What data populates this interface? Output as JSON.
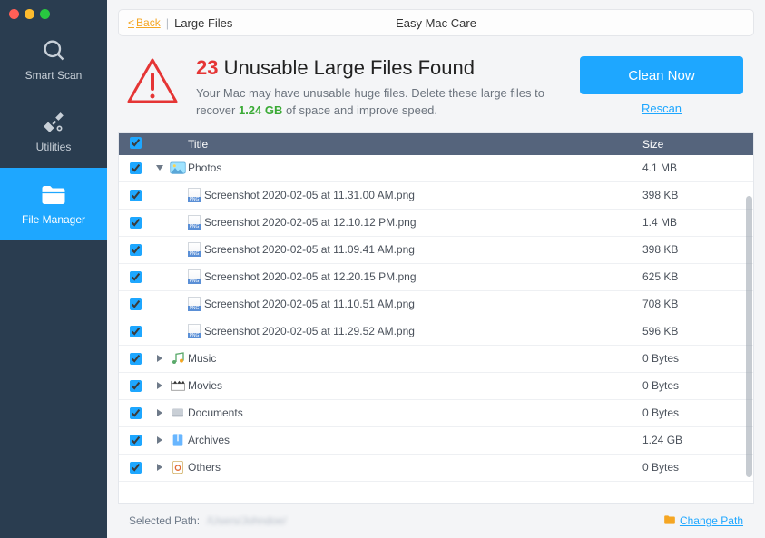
{
  "app": {
    "title": "Easy Mac Care"
  },
  "nav": {
    "items": [
      {
        "label": "Smart Scan"
      },
      {
        "label": "Utilities"
      },
      {
        "label": "File Manager"
      }
    ]
  },
  "breadcrumb": {
    "back": "Back",
    "current": "Large Files"
  },
  "header": {
    "count": "23",
    "title_rest": "Unusable Large Files Found",
    "subtitle_pre": "Your Mac may have unusable huge files. Delete these large files to recover ",
    "space": "1.24 GB",
    "subtitle_post": " of space and improve speed."
  },
  "actions": {
    "clean": "Clean Now",
    "rescan": "Rescan"
  },
  "columns": {
    "title": "Title",
    "size": "Size"
  },
  "groups": [
    {
      "label": "Photos",
      "size": "4.1 MB",
      "expanded": true,
      "icon": "photos",
      "children": [
        {
          "label": "Screenshot 2020-02-05 at 11.31.00 AM.png",
          "size": "398 KB"
        },
        {
          "label": "Screenshot 2020-02-05 at 12.10.12 PM.png",
          "size": "1.4 MB"
        },
        {
          "label": "Screenshot 2020-02-05 at 11.09.41 AM.png",
          "size": "398 KB"
        },
        {
          "label": "Screenshot 2020-02-05 at 12.20.15 PM.png",
          "size": "625 KB"
        },
        {
          "label": "Screenshot 2020-02-05 at 11.10.51 AM.png",
          "size": "708 KB"
        },
        {
          "label": "Screenshot 2020-02-05 at 11.29.52 AM.png",
          "size": "596 KB"
        }
      ]
    },
    {
      "label": "Music",
      "size": "0 Bytes",
      "expanded": false,
      "icon": "music"
    },
    {
      "label": "Movies",
      "size": "0 Bytes",
      "expanded": false,
      "icon": "movies"
    },
    {
      "label": "Documents",
      "size": "0 Bytes",
      "expanded": false,
      "icon": "documents"
    },
    {
      "label": "Archives",
      "size": "1.24 GB",
      "expanded": false,
      "icon": "archives"
    },
    {
      "label": "Others",
      "size": "0 Bytes",
      "expanded": false,
      "icon": "others"
    }
  ],
  "footer": {
    "selected_path_label": "Selected Path:",
    "selected_path_value": "/Users/Johndoe/",
    "change_path": "Change Path"
  }
}
